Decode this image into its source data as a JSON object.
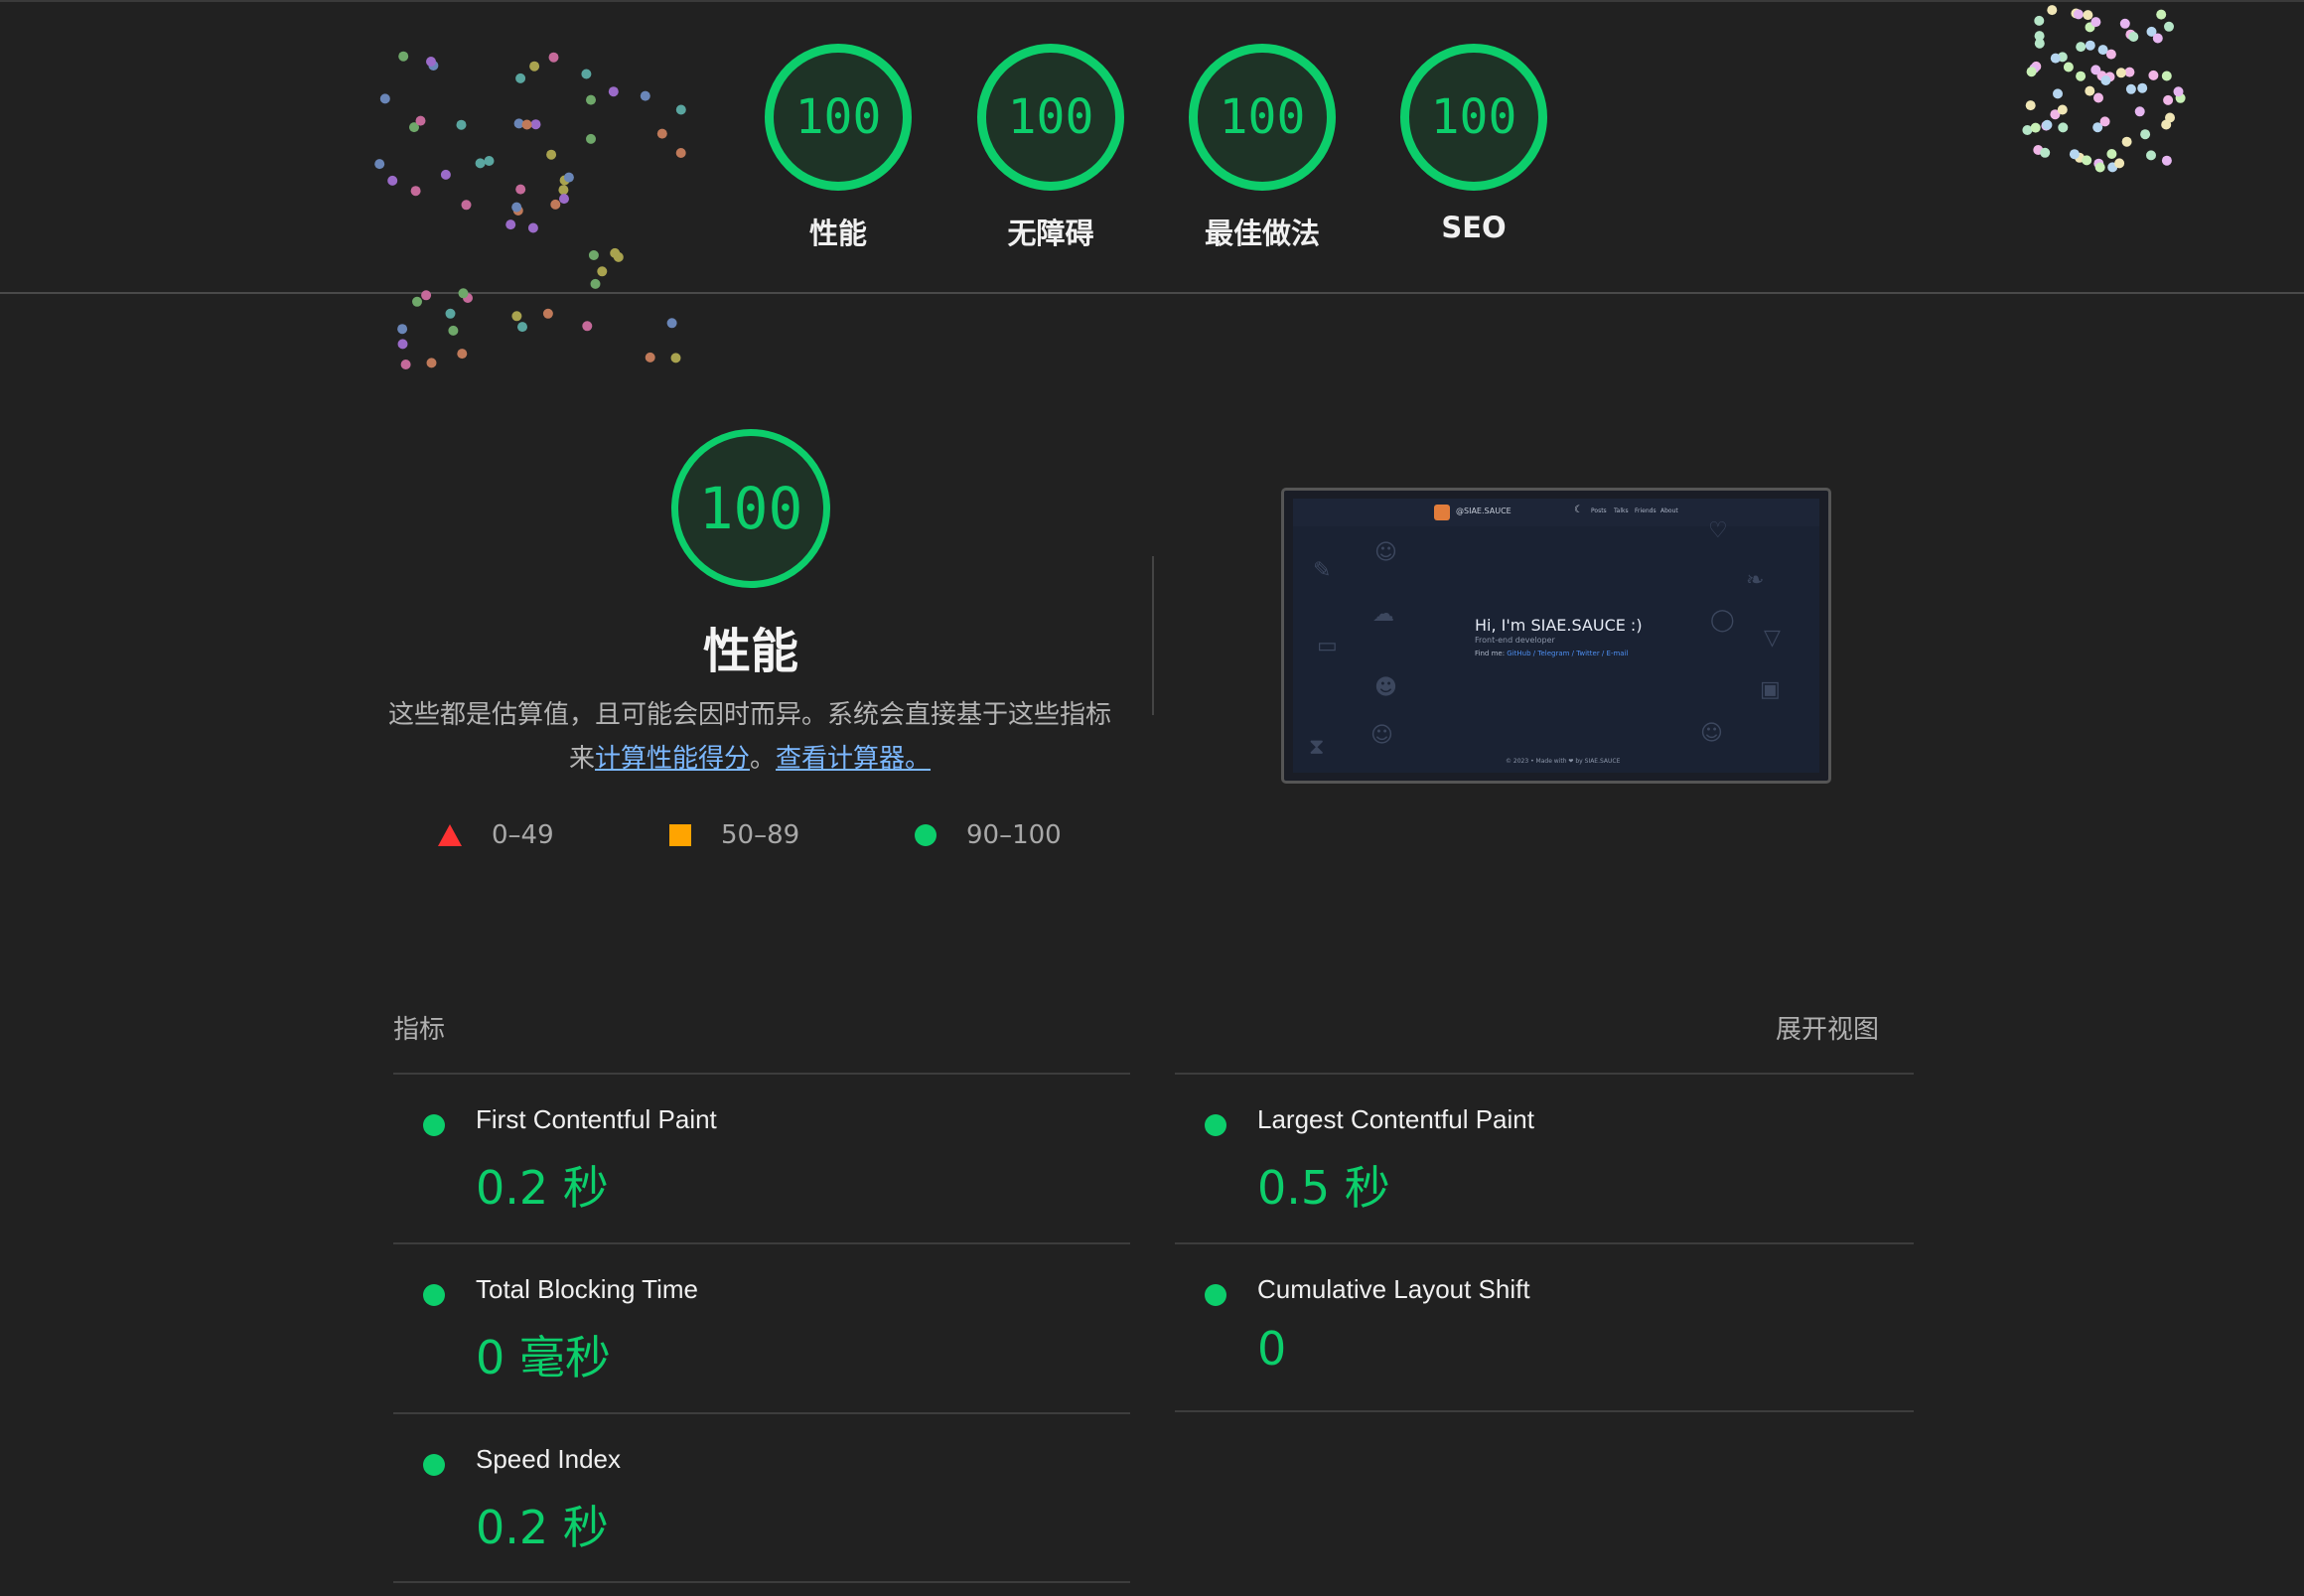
{
  "categories": [
    {
      "score": "100",
      "label": "性能"
    },
    {
      "score": "100",
      "label": "无障碍"
    },
    {
      "score": "100",
      "label": "最佳做法"
    },
    {
      "score": "100",
      "label": "SEO"
    }
  ],
  "performance": {
    "score": "100",
    "title": "性能",
    "desc_1": "这些都是估算值，且可能会因时而异。系统会直接基于这些指标来",
    "link_1": "计算性能得分",
    "desc_2": "。",
    "link_2": "查看计算器。"
  },
  "legend": [
    {
      "range": "0–49"
    },
    {
      "range": "50–89"
    },
    {
      "range": "90–100"
    }
  ],
  "preview": {
    "brand": "@SIAE.SAUCE",
    "nav": [
      "Posts",
      "Talks",
      "Friends",
      "About"
    ],
    "headline": "Hi, I'm SIAE.SAUCE :)",
    "subline": "Front-end developer",
    "find_label": "Find me:",
    "find_links": "GitHub / Telegram / Twitter / E-mail",
    "footer": "© 2023 • Made with ❤ by SIAE.SAUCE"
  },
  "metrics": {
    "section_title": "指标",
    "expand_label": "展开视图",
    "items": [
      {
        "name": "First Contentful Paint",
        "value": "0.2 秒"
      },
      {
        "name": "Largest Contentful Paint",
        "value": "0.5 秒"
      },
      {
        "name": "Total Blocking Time",
        "value": "0 毫秒"
      },
      {
        "name": "Cumulative Layout Shift",
        "value": "0"
      },
      {
        "name": "Speed Index",
        "value": "0.2 秒"
      }
    ]
  },
  "colors": {
    "pass": "#0cce6b",
    "average": "#ffa400",
    "fail": "#ff3333",
    "link": "#7cb8ff",
    "background": "#212121"
  }
}
